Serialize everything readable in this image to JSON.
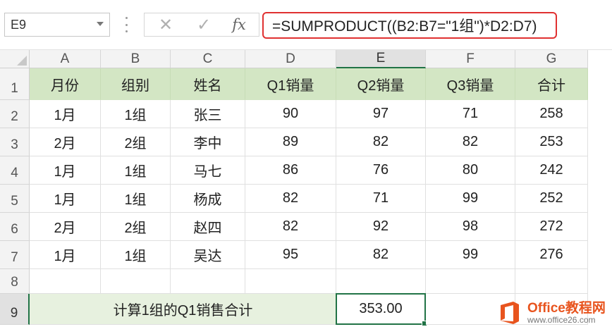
{
  "formula_bar": {
    "name_box": "E9",
    "cancel_glyph": "✕",
    "enter_glyph": "✓",
    "fx_label": "fx",
    "formula": "=SUMPRODUCT((B2:B7=\"1组\")*D2:D7)"
  },
  "columns": [
    "A",
    "B",
    "C",
    "D",
    "E",
    "F",
    "G"
  ],
  "rows": [
    "1",
    "2",
    "3",
    "4",
    "5",
    "6",
    "7",
    "8",
    "9"
  ],
  "table": {
    "headers": [
      "月份",
      "组别",
      "姓名",
      "Q1销量",
      "Q2销量",
      "Q3销量",
      "合计"
    ],
    "data": [
      [
        "1月",
        "1组",
        "张三",
        "90",
        "97",
        "71",
        "258"
      ],
      [
        "2月",
        "2组",
        "李中",
        "89",
        "82",
        "82",
        "253"
      ],
      [
        "1月",
        "1组",
        "马七",
        "86",
        "76",
        "80",
        "242"
      ],
      [
        "1月",
        "1组",
        "杨成",
        "82",
        "71",
        "99",
        "252"
      ],
      [
        "2月",
        "2组",
        "赵四",
        "82",
        "92",
        "98",
        "272"
      ],
      [
        "1月",
        "1组",
        "吴达",
        "95",
        "82",
        "99",
        "276"
      ]
    ]
  },
  "row9": {
    "label": "计算1组的Q1销售合计",
    "result": "353.00"
  },
  "active_cell": "E9",
  "colors": {
    "header_fill": "#d3e6c4",
    "label_fill": "#e7f1df",
    "selection": "#217346",
    "formula_outline": "#e03131"
  },
  "watermark": {
    "title": "Office教程网",
    "url": "www.office26.com",
    "icon": "office-logo-icon"
  }
}
